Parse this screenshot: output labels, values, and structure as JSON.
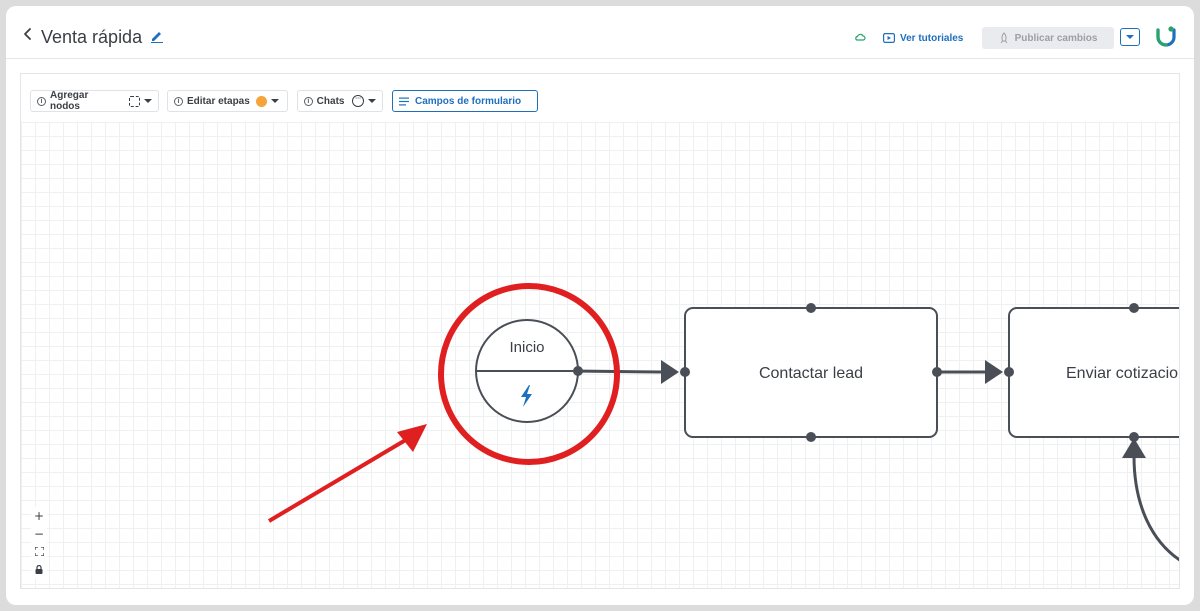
{
  "header": {
    "title": "Venta rápida",
    "tutorials_label": "Ver tutoriales",
    "publish_label": "Publicar cambios"
  },
  "toolbar": {
    "add_nodes_label": "Agregar nodos",
    "edit_stages_label": "Editar etapas",
    "chats_label": "Chats",
    "form_fields_label": "Campos de formulario"
  },
  "flow": {
    "start_label": "Inicio",
    "node1_label": "Contactar lead",
    "node2_label": "Enviar cotizacio"
  },
  "zoom": {
    "in": "+",
    "out": "−",
    "fit": "⛶",
    "lock": "🔒"
  },
  "colors": {
    "accent": "#1f6fbf",
    "node_stroke": "#4a4f57",
    "annotation": "#e02020",
    "stage_dot": "#f5a33a"
  }
}
